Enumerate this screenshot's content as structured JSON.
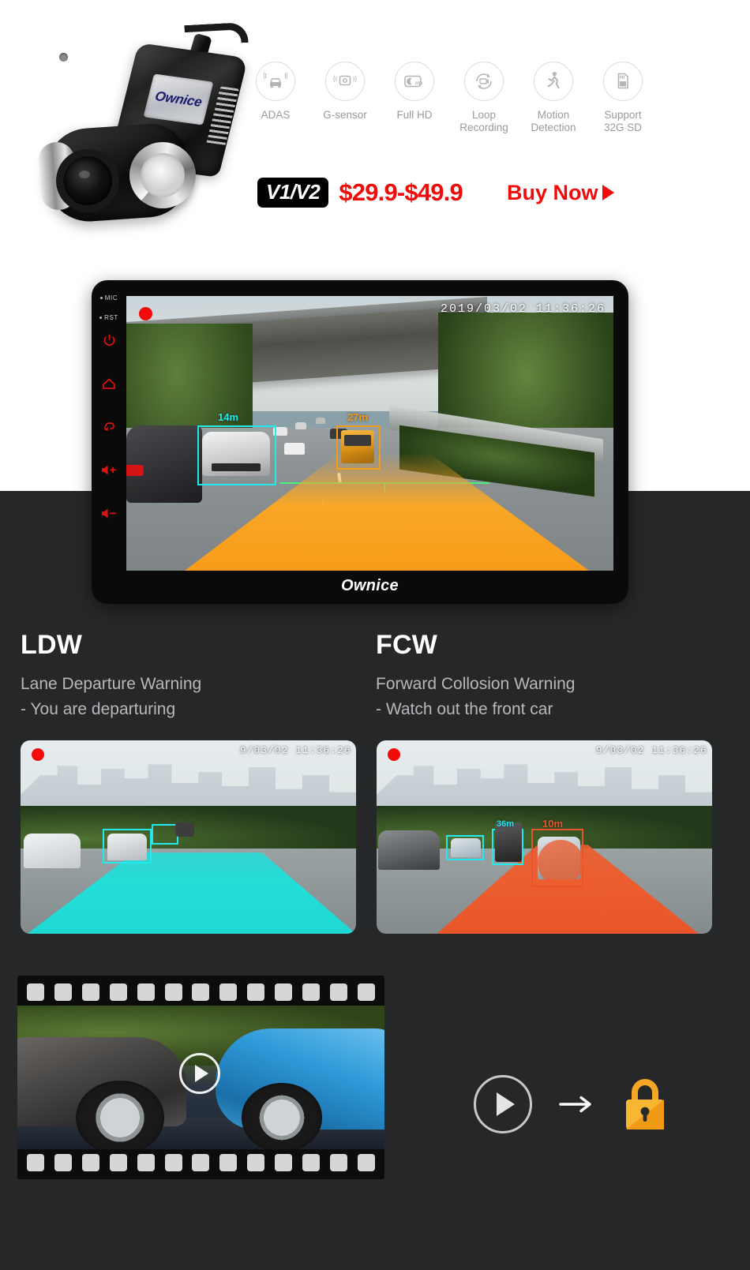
{
  "hero": {
    "product": {
      "brand_on_device": "Ownice",
      "alt": "ownice-dashcam-product-photo"
    },
    "features": [
      {
        "label": "ADAS",
        "icon": "car-adas-icon"
      },
      {
        "label": "G-sensor",
        "icon": "g-sensor-icon"
      },
      {
        "label": "Full HD",
        "icon": "full-hd-icon"
      },
      {
        "label": "Loop\nRecording",
        "label_line1": "Loop",
        "label_line2": "Recording",
        "icon": "loop-recording-icon"
      },
      {
        "label": "Motion\nDetection",
        "label_line1": "Motion",
        "label_line2": "Detection",
        "icon": "motion-detection-icon"
      },
      {
        "label": "Support\n32G SD",
        "label_line1": "Support",
        "label_line2": "32G SD",
        "icon": "sd-card-icon"
      }
    ],
    "cta": {
      "model_badge": "V1/V2",
      "price": "$29.9-$49.9",
      "buy_label": "Buy Now",
      "arrow_icon": "play-triangle-icon",
      "accent_color": "#f00b0b"
    }
  },
  "device": {
    "brand": "Ownice",
    "side_keys": [
      {
        "label": "MIC",
        "icon": "mic-indicator-icon"
      },
      {
        "label": "RST",
        "icon": "reset-indicator-icon"
      },
      {
        "label": "",
        "icon": "power-icon"
      },
      {
        "label": "",
        "icon": "home-icon"
      },
      {
        "label": "",
        "icon": "back-icon"
      },
      {
        "label": "",
        "icon": "volume-up-icon"
      },
      {
        "label": "",
        "icon": "volume-down-icon"
      }
    ],
    "screen": {
      "timestamp": "2019/03/02 11:36:26",
      "recording_indicator": "rec-dot-icon",
      "adas_overlays": [
        {
          "label": "14m",
          "color": "#23e8ee",
          "target": "lead-car"
        },
        {
          "label": "27m",
          "color": "#f59a16",
          "target": "truck"
        }
      ]
    }
  },
  "warnings": [
    {
      "code": "LDW",
      "name": "Lane Departure Warning",
      "detail": "- You are departuring",
      "shot_timestamp": "9/03/02 11:36:26",
      "lane_color": "#23ded8"
    },
    {
      "code": "FCW",
      "name": "Forward Collosion Warning",
      "detail": "- Watch out the front car",
      "shot_timestamp": "9/03/02 11:36:26",
      "lane_color": "#ec5e2f"
    }
  ],
  "media": {
    "film_strip": {
      "alt": "car-collision-video-thumbnail",
      "perforations": 13,
      "play_icon": "play-circle-icon"
    },
    "action_sequence": {
      "play_icon": "play-circle-icon",
      "arrow_icon": "arrow-right-icon",
      "lock_icon": "lock-icon",
      "lock_color": "#f5a623"
    }
  }
}
